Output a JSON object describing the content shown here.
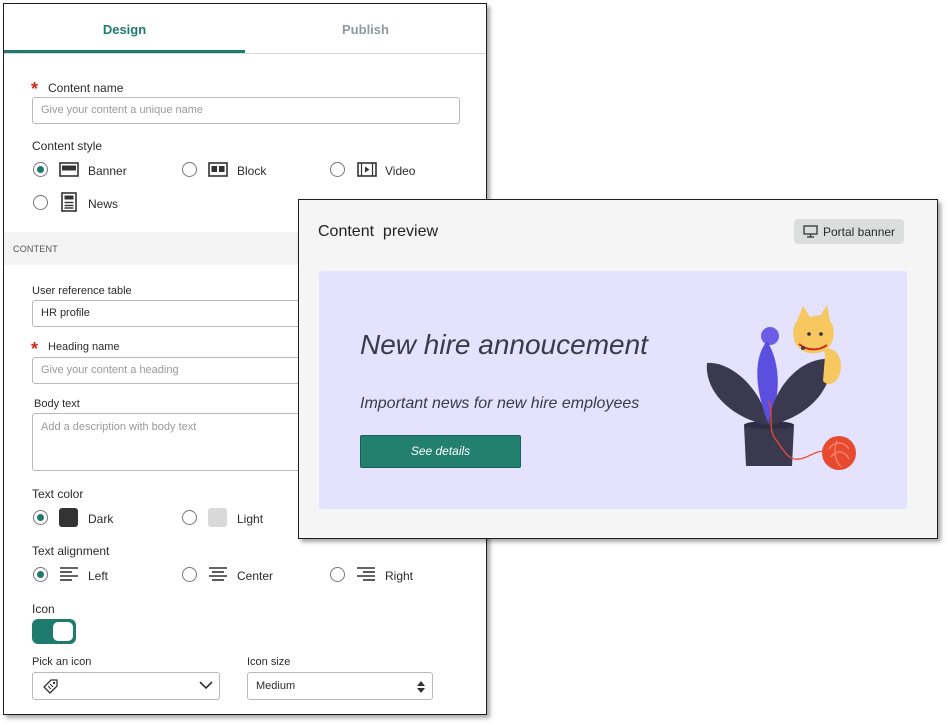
{
  "tabs": [
    {
      "label": "Design",
      "active": true
    },
    {
      "label": "Publish",
      "active": false
    }
  ],
  "form": {
    "content_name": {
      "label": "Content name",
      "placeholder": "Give your content a unique name"
    },
    "content_style": {
      "label": "Content style",
      "options": [
        {
          "label": "Banner",
          "icon": "banner-icon",
          "selected": true
        },
        {
          "label": "Block",
          "icon": "block-icon",
          "selected": false
        },
        {
          "label": "Video",
          "icon": "video-icon",
          "selected": false
        },
        {
          "label": "News",
          "icon": "news-icon",
          "selected": false
        }
      ]
    },
    "section_header": "CONTENT",
    "user_reference_table": {
      "label": "User reference table",
      "value": "HR profile"
    },
    "heading_name": {
      "label": "Heading name",
      "placeholder": "Give your content a heading"
    },
    "body_text": {
      "label": "Body text",
      "placeholder": "Add a description with body text"
    },
    "text_color": {
      "label": "Text color",
      "options": [
        {
          "label": "Dark",
          "swatch": "#333333",
          "selected": true
        },
        {
          "label": "Light",
          "swatch": "#d9d9d9",
          "selected": false
        }
      ]
    },
    "text_alignment": {
      "label": "Text alignment",
      "options": [
        {
          "label": "Left",
          "icon": "align-left-icon",
          "selected": true
        },
        {
          "label": "Center",
          "icon": "align-center-icon",
          "selected": false
        },
        {
          "label": "Right",
          "icon": "align-right-icon",
          "selected": false
        }
      ]
    },
    "icon_toggle": {
      "label": "Icon",
      "on": true
    },
    "pick_icon": {
      "label": "Pick an icon",
      "value_icon": "tag-icon"
    },
    "icon_size": {
      "label": "Icon size",
      "value": "Medium"
    }
  },
  "preview": {
    "title": "Content  preview",
    "badge": "Portal banner",
    "banner": {
      "heading": "New hire annoucement",
      "subheading": "Important news for new hire employees",
      "button": "See details"
    }
  },
  "colors": {
    "accent": "#1f7b6e",
    "required": "#d0271d",
    "banner_bg": "#e4e2fc",
    "button_bg": "#23806f"
  }
}
